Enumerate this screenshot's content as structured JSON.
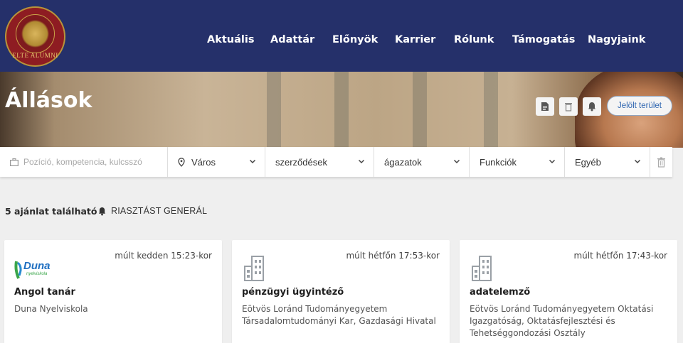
{
  "header": {
    "logo_text": "ELTE ALUMNI",
    "nav": [
      "Aktuális",
      "Adattár",
      "Előnyök",
      "Karrier",
      "Rólunk",
      "Támogatás",
      "Nagyjaink"
    ]
  },
  "hero": {
    "title": "Állások",
    "marked_area_button": "Jelölt terület"
  },
  "filters": {
    "search_placeholder": "Pozíció, kompetencia, kulcsszó",
    "city": "Város",
    "contracts": "szerződések",
    "sectors": "ágazatok",
    "functions": "Funkciók",
    "other": "Egyéb"
  },
  "results": {
    "count_text": "5 ajánlat található",
    "alert_text": "RIASZTÁST GENERÁL"
  },
  "jobs": [
    {
      "time": "múlt kedden 15:23-kor",
      "title": "Angol tanár",
      "org": "Duna Nyelviskola",
      "logo_text": "Duna",
      "logo_subtext": "nyelviskola"
    },
    {
      "time": "múlt hétfőn 17:53-kor",
      "title": "pénzügyi ügyintéző",
      "org": "Eötvös Loránd Tudományegyetem Társadalomtudományi Kar, Gazdasági Hivatal"
    },
    {
      "time": "múlt hétfőn 17:43-kor",
      "title": "adatelemző",
      "org": "Eötvös Loránd Tudományegyetem Oktatási Igazgatóság, Oktatásfejlesztési és Tehetséggondozási Osztály"
    }
  ],
  "colors": {
    "header_bg": "#25306a",
    "accent_blue": "#2f66b1",
    "logo_red": "#8e1c22",
    "gold": "#b8943a"
  }
}
